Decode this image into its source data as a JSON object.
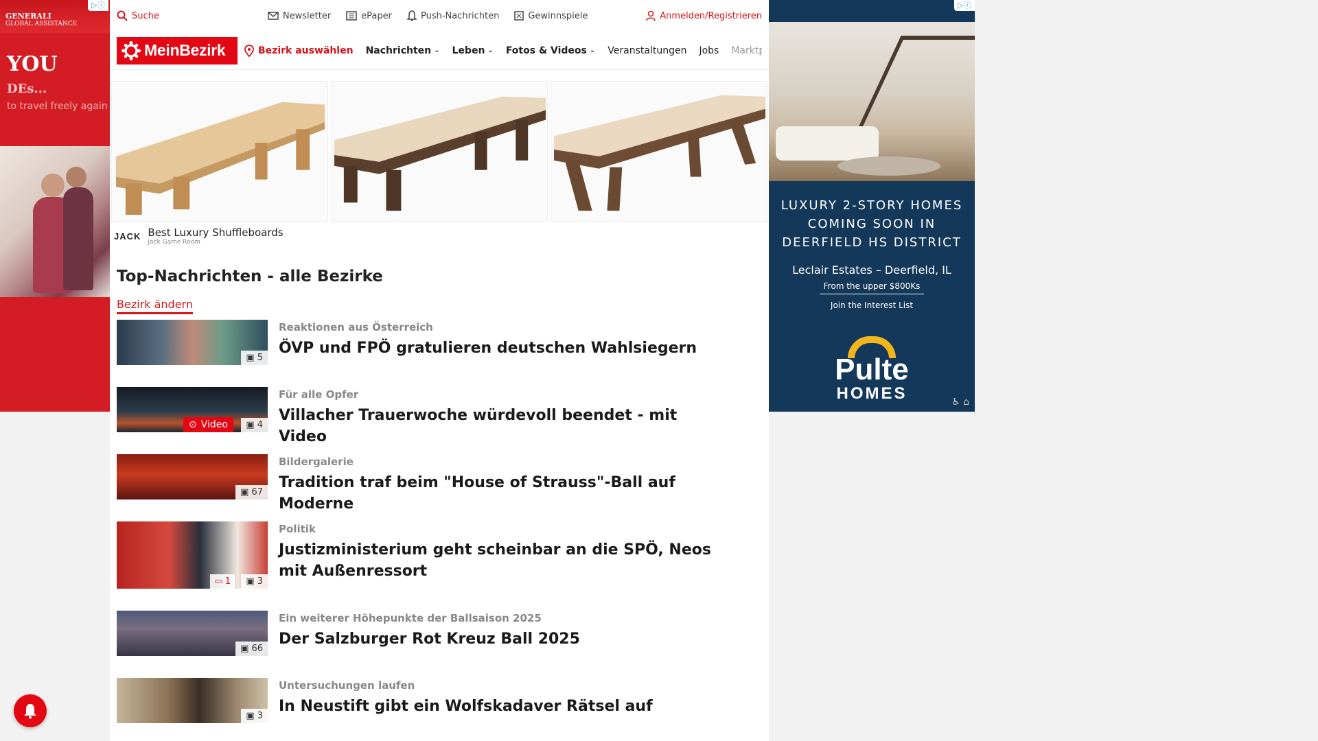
{
  "left_ad": {
    "brand_line1": "GENERALI",
    "brand_line2": "GLOBAL ASSISTANCE",
    "big_text": "YOU",
    "mid_text": "DEs...",
    "small_text": "to travel freely again"
  },
  "utility": {
    "search": "Suche",
    "newsletter": "Newsletter",
    "epaper": "ePaper",
    "push": "Push-Nachrichten",
    "gewinnspiele": "Gewinnspiele",
    "login": "Anmelden/Registrieren"
  },
  "nav": {
    "logo": "MeinBezirk",
    "district": "Bezirk auswählen",
    "items": [
      "Nachrichten",
      "Leben",
      "Fotos & Videos",
      "Veranstaltungen",
      "Jobs",
      "Marktplatz"
    ]
  },
  "shuffle_ad": {
    "logo": "JACK",
    "title": "Best Luxury Shuffleboards",
    "sub": "Jack Game Room"
  },
  "section": {
    "title": "Top-Nachrichten - alle Bezirke",
    "change": "Bezirk ändern"
  },
  "news": [
    {
      "kicker": "Reaktionen aus Österreich",
      "headline": "ÖVP und FPÖ gratulieren deutschen Wahlsiegern",
      "photos": "5"
    },
    {
      "kicker": "Für alle Opfer",
      "headline": "Villacher Trauerwoche würdevoll beendet - mit Video",
      "photos": "4",
      "video": "Video"
    },
    {
      "kicker": "Bildergalerie",
      "headline": "Tradition traf beim \"House of Strauss\"-Ball auf Moderne",
      "photos": "67"
    },
    {
      "kicker": "Politik",
      "headline": "Justizministerium geht scheinbar an die SPÖ, Neos mit Außenressort",
      "photos": "3",
      "comments": "1"
    },
    {
      "kicker": "Ein weiterer Höhepunkte der Ballsaison 2025",
      "headline": "Der Salzburger Rot Kreuz Ball 2025",
      "photos": "66"
    },
    {
      "kicker": "Untersuchungen laufen",
      "headline": "In Neustift gibt ein Wolfskadaver Rätsel auf",
      "photos": "3"
    }
  ],
  "right_ad": {
    "headline": "LUXURY 2-STORY HOMES COMING SOON IN DEERFIELD HS DISTRICT",
    "estate": "Leclair Estates – Deerfield, IL",
    "price": "From the upper $800Ks",
    "interest": "Join the Interest List",
    "brand1": "Pulte",
    "brand2": "HOMES"
  },
  "colors": {
    "brand_red": "#e30613",
    "ad_navy": "#14385a"
  }
}
